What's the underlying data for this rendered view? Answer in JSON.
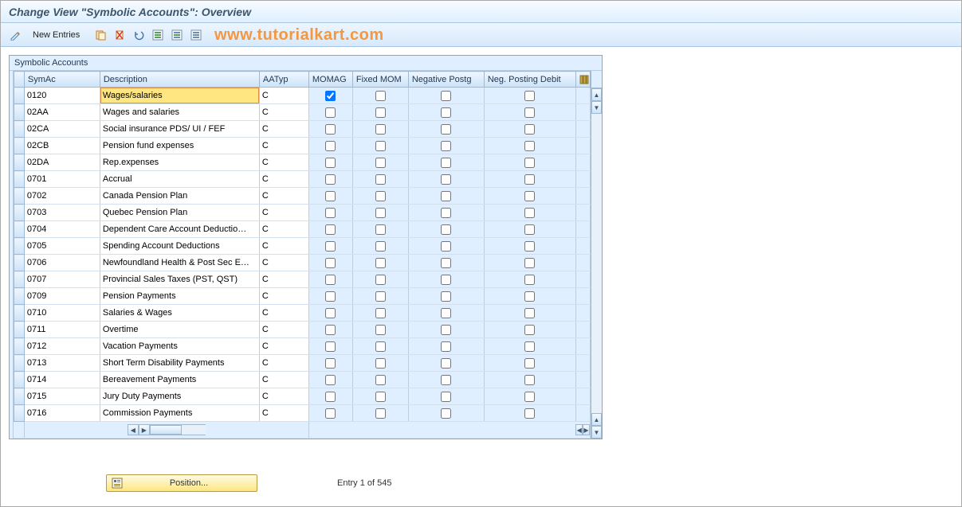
{
  "title": "Change View \"Symbolic Accounts\": Overview",
  "toolbar": {
    "new_entries_label": "New Entries"
  },
  "watermark": "www.tutorialkart.com",
  "grid": {
    "title": "Symbolic Accounts",
    "columns": {
      "symac": "SymAc",
      "description": "Description",
      "aatyp": "AATyp",
      "momag": "MOMAG",
      "fixed_mom": "Fixed MOM",
      "negative_postg": "Negative Postg",
      "neg_posting_debit": "Neg. Posting Debit"
    },
    "rows": [
      {
        "symac": "0120",
        "description": "Wages/salaries",
        "aatyp": "C",
        "momag": true,
        "fixed_mom": false,
        "negative_postg": false,
        "neg_posting_debit": false,
        "active": true
      },
      {
        "symac": "02AA",
        "description": "Wages and salaries",
        "aatyp": "C",
        "momag": false,
        "fixed_mom": false,
        "negative_postg": false,
        "neg_posting_debit": false
      },
      {
        "symac": "02CA",
        "description": "Social insurance PDS/ UI / FEF",
        "aatyp": "C",
        "momag": false,
        "fixed_mom": false,
        "negative_postg": false,
        "neg_posting_debit": false
      },
      {
        "symac": "02CB",
        "description": "Pension fund expenses",
        "aatyp": "C",
        "momag": false,
        "fixed_mom": false,
        "negative_postg": false,
        "neg_posting_debit": false
      },
      {
        "symac": "02DA",
        "description": "Rep.expenses",
        "aatyp": "C",
        "momag": false,
        "fixed_mom": false,
        "negative_postg": false,
        "neg_posting_debit": false
      },
      {
        "symac": "0701",
        "description": "Accrual",
        "aatyp": "C",
        "momag": false,
        "fixed_mom": false,
        "negative_postg": false,
        "neg_posting_debit": false
      },
      {
        "symac": "0702",
        "description": "Canada Pension Plan",
        "aatyp": "C",
        "momag": false,
        "fixed_mom": false,
        "negative_postg": false,
        "neg_posting_debit": false
      },
      {
        "symac": "0703",
        "description": "Quebec Pension Plan",
        "aatyp": "C",
        "momag": false,
        "fixed_mom": false,
        "negative_postg": false,
        "neg_posting_debit": false
      },
      {
        "symac": "0704",
        "description": "Dependent Care Account Deductio…",
        "aatyp": "C",
        "momag": false,
        "fixed_mom": false,
        "negative_postg": false,
        "neg_posting_debit": false
      },
      {
        "symac": "0705",
        "description": "Spending Account Deductions",
        "aatyp": "C",
        "momag": false,
        "fixed_mom": false,
        "negative_postg": false,
        "neg_posting_debit": false
      },
      {
        "symac": "0706",
        "description": "Newfoundland Health & Post Sec E…",
        "aatyp": "C",
        "momag": false,
        "fixed_mom": false,
        "negative_postg": false,
        "neg_posting_debit": false
      },
      {
        "symac": "0707",
        "description": "Provincial Sales Taxes (PST, QST)",
        "aatyp": "C",
        "momag": false,
        "fixed_mom": false,
        "negative_postg": false,
        "neg_posting_debit": false
      },
      {
        "symac": "0709",
        "description": "Pension Payments",
        "aatyp": "C",
        "momag": false,
        "fixed_mom": false,
        "negative_postg": false,
        "neg_posting_debit": false
      },
      {
        "symac": "0710",
        "description": "Salaries & Wages",
        "aatyp": "C",
        "momag": false,
        "fixed_mom": false,
        "negative_postg": false,
        "neg_posting_debit": false
      },
      {
        "symac": "0711",
        "description": "Overtime",
        "aatyp": "C",
        "momag": false,
        "fixed_mom": false,
        "negative_postg": false,
        "neg_posting_debit": false
      },
      {
        "symac": "0712",
        "description": "Vacation Payments",
        "aatyp": "C",
        "momag": false,
        "fixed_mom": false,
        "negative_postg": false,
        "neg_posting_debit": false
      },
      {
        "symac": "0713",
        "description": "Short Term Disability Payments",
        "aatyp": "C",
        "momag": false,
        "fixed_mom": false,
        "negative_postg": false,
        "neg_posting_debit": false
      },
      {
        "symac": "0714",
        "description": "Bereavement Payments",
        "aatyp": "C",
        "momag": false,
        "fixed_mom": false,
        "negative_postg": false,
        "neg_posting_debit": false
      },
      {
        "symac": "0715",
        "description": "Jury Duty Payments",
        "aatyp": "C",
        "momag": false,
        "fixed_mom": false,
        "negative_postg": false,
        "neg_posting_debit": false
      },
      {
        "symac": "0716",
        "description": "Commission Payments",
        "aatyp": "C",
        "momag": false,
        "fixed_mom": false,
        "negative_postg": false,
        "neg_posting_debit": false
      }
    ]
  },
  "footer": {
    "position_label": "Position...",
    "entry_status": "Entry 1 of 545"
  }
}
